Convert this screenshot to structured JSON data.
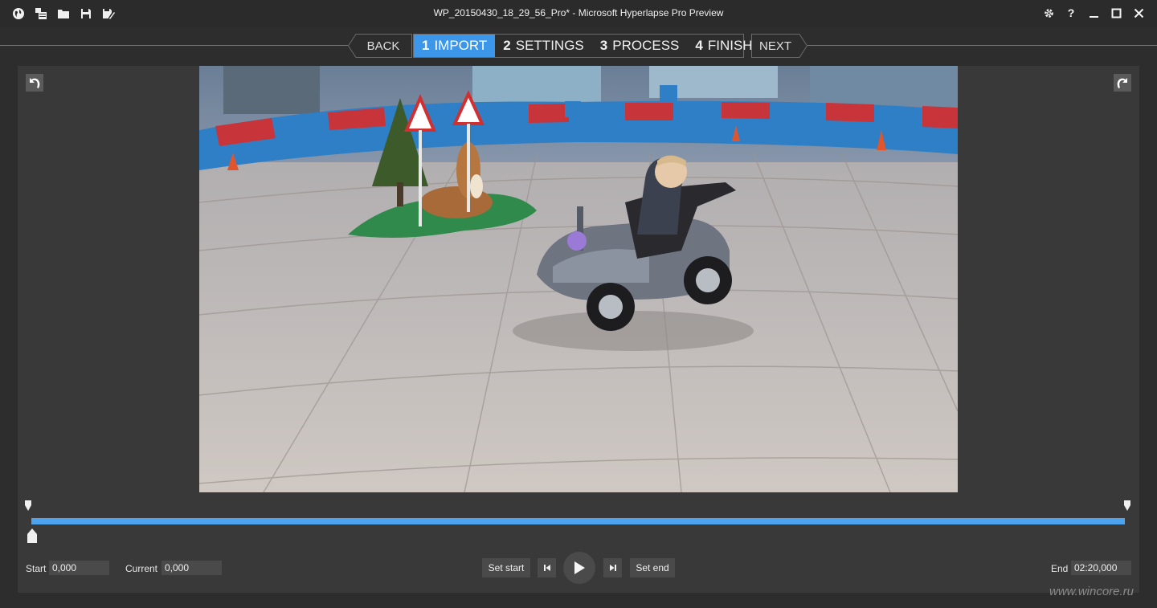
{
  "window": {
    "title": "WP_20150430_18_29_56_Pro* - Microsoft Hyperlapse Pro Preview",
    "toolbar_icons": [
      "globe-icon",
      "import-icon",
      "folder-icon",
      "save-icon",
      "save-as-icon"
    ],
    "controls_icons": [
      "gear-icon",
      "help-icon",
      "minimize-icon",
      "maximize-icon",
      "close-icon"
    ],
    "help_glyph": "?"
  },
  "wizard": {
    "back_label": "BACK",
    "next_label": "NEXT",
    "steps": [
      {
        "num": "1",
        "label": "IMPORT",
        "active": true
      },
      {
        "num": "2",
        "label": "SETTINGS",
        "active": false
      },
      {
        "num": "3",
        "label": "PROCESS",
        "active": false
      },
      {
        "num": "4",
        "label": "FINISH",
        "active": false
      }
    ]
  },
  "viewer": {
    "rotate_left_icon": "rotate-left-icon",
    "rotate_right_icon": "rotate-right-icon",
    "timeline_color": "#4da3ee"
  },
  "controls": {
    "start_label": "Start",
    "start_value": "0,000",
    "current_label": "Current",
    "current_value": "0,000",
    "set_start_label": "Set start",
    "set_end_label": "Set end",
    "end_label": "End",
    "end_value": "02:20,000"
  },
  "watermark": "www.wincore.ru",
  "colors": {
    "accent": "#3c96ea",
    "background": "#2d2d2d",
    "panel": "#393939"
  }
}
